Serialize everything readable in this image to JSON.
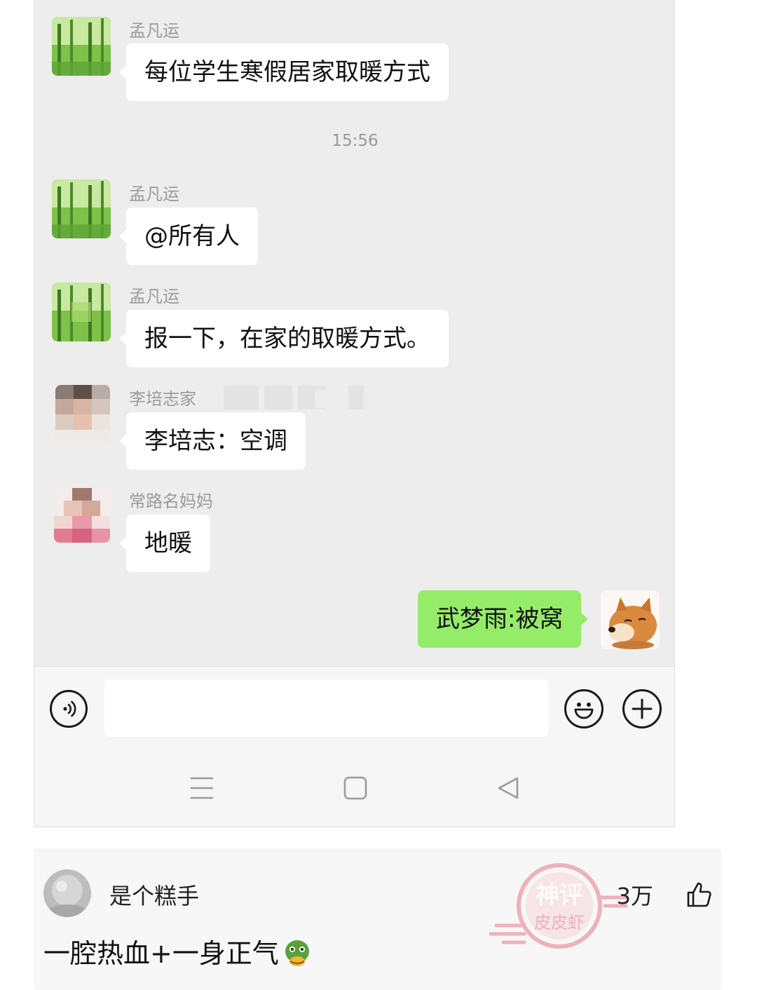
{
  "chat": {
    "timestamp": "15:56",
    "messages": [
      {
        "sender": "孟凡运",
        "text": "每位学生寒假居家取暖方式"
      },
      {
        "sender": "孟凡运",
        "text": "@所有人"
      },
      {
        "sender": "孟凡运",
        "text": "报一下，在家的取暖方式。"
      },
      {
        "sender": "李培志家",
        "text": "李培志：空调"
      },
      {
        "sender": "常路名妈妈",
        "text": "地暖"
      },
      {
        "sender": "",
        "text": "武梦雨:被窝"
      }
    ]
  },
  "input_bar": {
    "voice_icon": "voice-icon",
    "emoji_icon": "smiley-icon",
    "plus_icon": "plus-icon"
  },
  "nav_bar": {
    "icons": [
      "menu-icon",
      "home-square-icon",
      "back-triangle-icon"
    ]
  },
  "comment": {
    "username": "是个糕手",
    "likes": "3万",
    "text": "一腔热血+一身正气",
    "stamp_text": [
      "神评",
      "皮皮虾"
    ]
  },
  "colors": {
    "chat_bg": "#ededed",
    "my_bubble": "#95ec69",
    "other_bubble": "#ffffff",
    "sender_text": "#9b9b9b"
  }
}
